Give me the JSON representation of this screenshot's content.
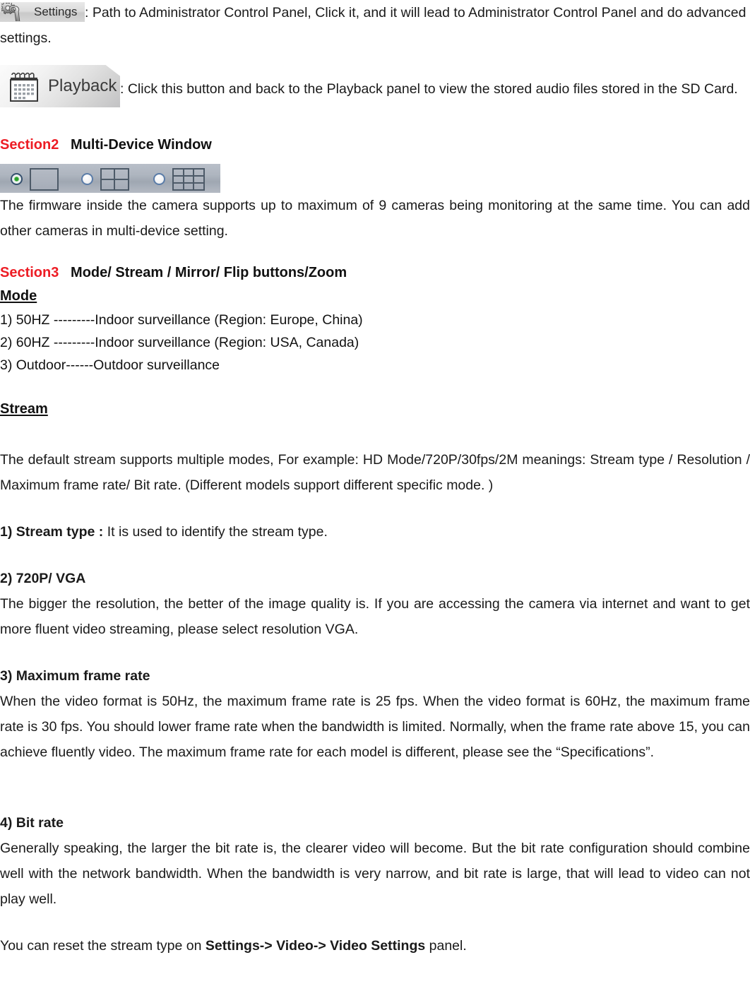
{
  "document": {
    "title": "IP Camera User Manual - Sections 2 and 3"
  },
  "settings_block": {
    "button": {
      "label": "Settings",
      "icon": "gear-wrench-icon"
    },
    "text": ":    Path to Administrator Control Panel, Click it, and it will lead to Administrator Control Panel and do advanced settings."
  },
  "playback_block": {
    "button": {
      "label": "Playback",
      "icon": "calendar-icon"
    },
    "text": ": Click this button and back to the Playback panel to view the stored audio files stored in the SD Card."
  },
  "section2": {
    "number": "Section2",
    "separator": "   ",
    "title": "Multi-Device Window",
    "toolbar": {
      "items": [
        {
          "name": "single-view",
          "selected": true,
          "grid": "1x1"
        },
        {
          "name": "quad-view",
          "selected": false,
          "grid": "2x2"
        },
        {
          "name": "nine-view",
          "selected": false,
          "grid": "3x3"
        }
      ]
    },
    "body": "The firmware inside the camera supports up to maximum of 9 cameras being monitoring at the same time. You can add other cameras in multi-device setting."
  },
  "section3": {
    "number": "Section3",
    "separator": "   ",
    "title": "Mode/ Stream / Mirror/ Flip buttons/Zoom",
    "mode": {
      "heading": "Mode",
      "items": [
        "1) 50HZ ---------Indoor surveillance (Region: Europe, China)",
        "2) 60HZ ---------Indoor surveillance (Region: USA, Canada)",
        "3) Outdoor------Outdoor surveillance"
      ]
    },
    "stream": {
      "heading": "Stream",
      "intro": "The default stream supports multiple modes, For example: HD Mode/720P/30fps/2M meanings: Stream type / Resolution / Maximum frame rate/ Bit rate. (Different models support different specific mode. )",
      "items": [
        {
          "label": "1) Stream type :",
          "inline_text": " It is used to identify the stream type.",
          "body": ""
        },
        {
          "label": "2) 720P/ VGA",
          "inline_text": "",
          "body": "The bigger the resolution, the better of the image quality is. If you are accessing the camera via internet and want to get more fluent video streaming, please select resolution VGA."
        },
        {
          "label": "3) Maximum frame rate",
          "inline_text": "",
          "body": "When the video format is 50Hz, the maximum frame rate is 25 fps. When the video format is 60Hz, the maximum frame rate is 30 fps. You should lower frame rate when the bandwidth is limited. Normally, when the frame rate above 15, you can achieve fluently video. The maximum frame rate for each model is different, please see the “Specifications”."
        },
        {
          "label": "4) Bit rate",
          "inline_text": "",
          "body": "Generally speaking, the larger the bit rate is, the clearer video will become. But the bit rate configuration should combine well with the network bandwidth. When the bandwidth is very narrow, and bit rate is large, that will lead to video can not play well."
        }
      ],
      "footer": {
        "prefix": "You can reset the stream type on ",
        "bold": "Settings-> Video-> Video Settings",
        "suffix": " panel."
      }
    }
  },
  "colors": {
    "section_number_red": "#ED1C24",
    "body_text": "#1a1a1a",
    "toolbar_gradient_top": "#b9bfc9",
    "toolbar_gradient_bottom": "#b4bac3",
    "radio_selected_green": "#2fa82f",
    "grid_border": "#4d5a68"
  }
}
